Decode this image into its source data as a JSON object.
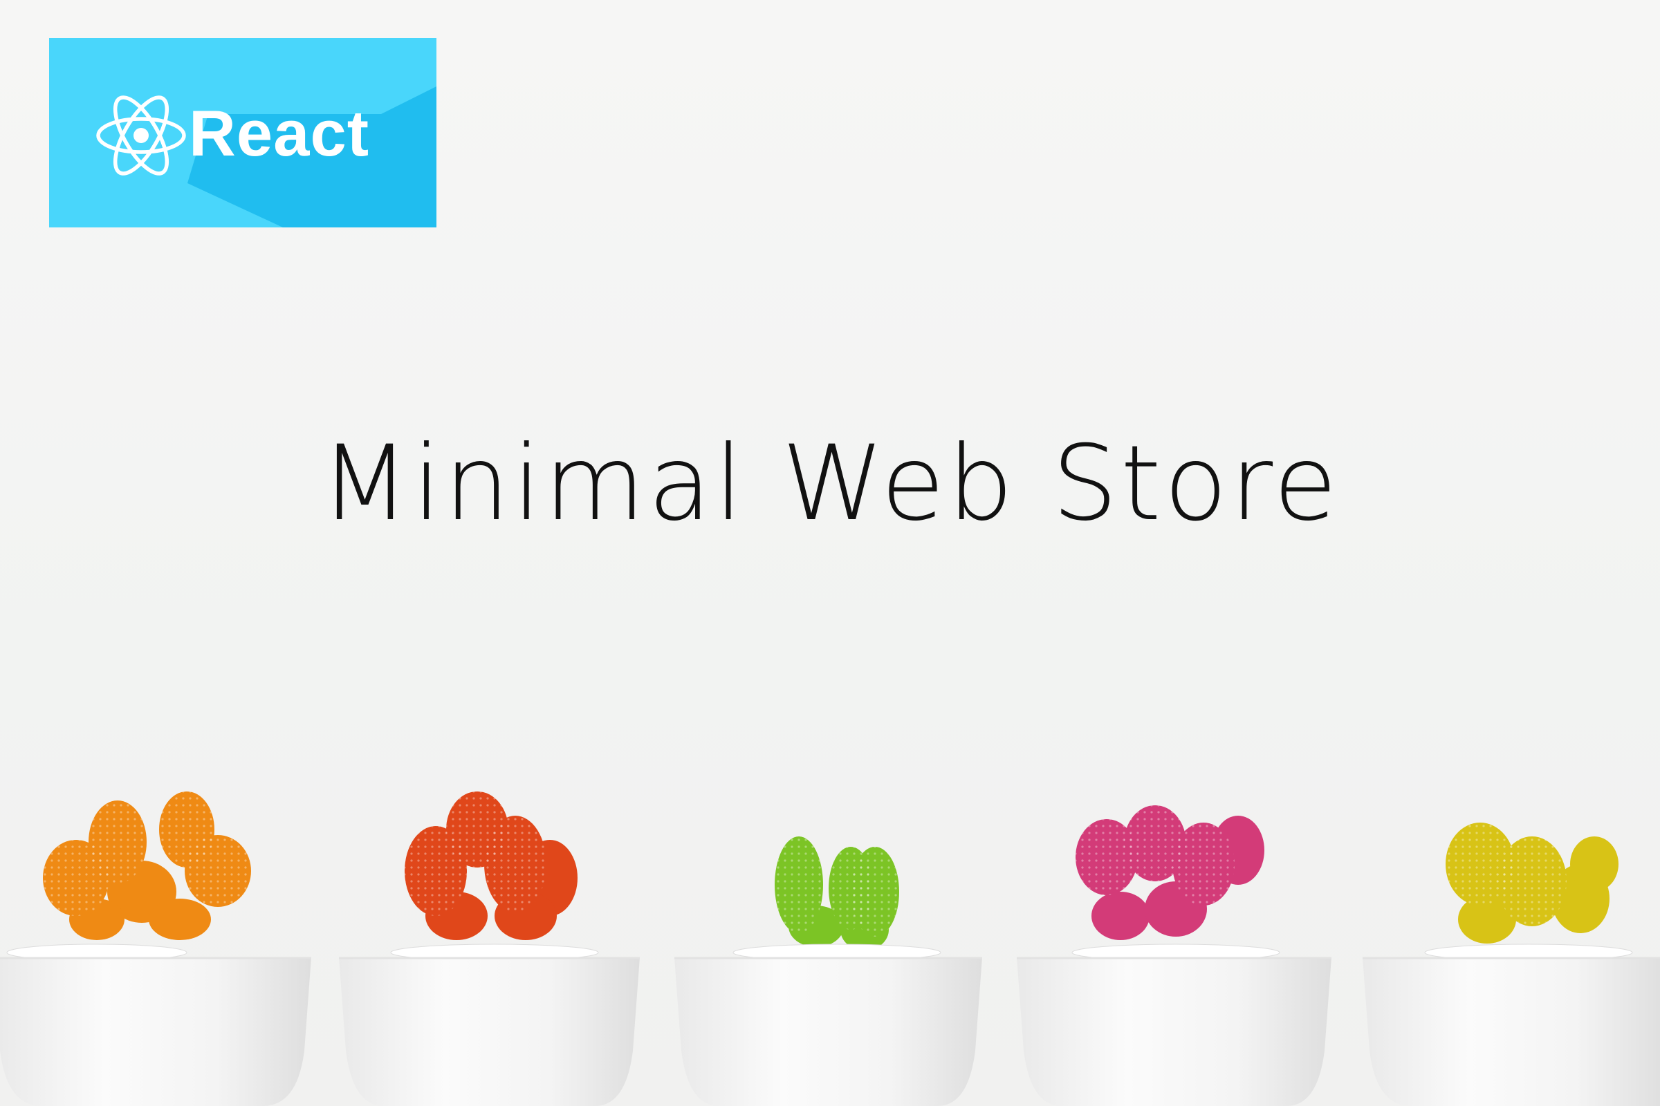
{
  "logo": {
    "text": "React",
    "icon": "react-atom-icon",
    "background_color": "#49d6fb",
    "shadow_color": "#18b8ea"
  },
  "hero": {
    "title": "Minimal Web Store"
  },
  "decor": {
    "image": "row-of-potted-cacti",
    "pot_color": "#f7f7f7",
    "cactus_colors": [
      "#ef8a14",
      "#e0471a",
      "#7cc425",
      "#d33b78",
      "#d8c316"
    ]
  }
}
